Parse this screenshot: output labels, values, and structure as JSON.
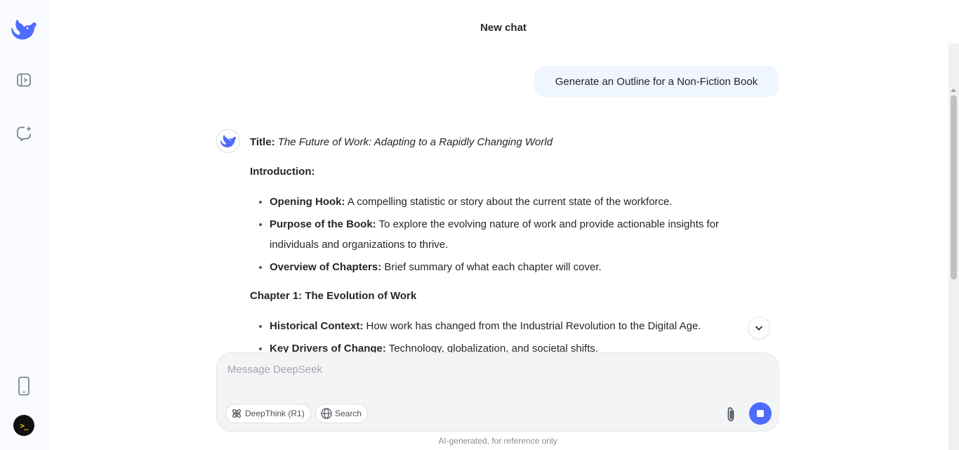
{
  "header": {
    "title": "New chat"
  },
  "user_message": {
    "text": "Generate an Outline for a Non-Fiction Book"
  },
  "answer": {
    "title_label": "Title:",
    "title_text": "The Future of Work: Adapting to a Rapidly Changing World",
    "intro_heading": "Introduction:",
    "intro_items": [
      {
        "label": "Opening Hook:",
        "text": "A compelling statistic or story about the current state of the workforce."
      },
      {
        "label": "Purpose of the Book:",
        "text": "To explore the evolving nature of work and provide actionable insights for individuals and organizations to thrive."
      },
      {
        "label": "Overview of Chapters:",
        "text": "Brief summary of what each chapter will cover."
      }
    ],
    "chapter1_heading": "Chapter 1: The Evolution of Work",
    "chapter1_items": [
      {
        "label": "Historical Context:",
        "text": "How work has changed from the Industrial Revolution to the Digital Age."
      },
      {
        "label": "Key Drivers of Change:",
        "text": "Technology, globalization, and societal shifts."
      }
    ]
  },
  "composer": {
    "placeholder": "Message DeepSeek",
    "deepthink_label": "DeepThink (R1)",
    "search_label": "Search"
  },
  "footer": {
    "note": "AI-generated, for reference only"
  },
  "colors": {
    "accent": "#4d6bfe",
    "user_bubble": "#eff6ff",
    "sidebar_bg": "#f9fbff"
  },
  "icons": {
    "logo": "whale-logo-icon",
    "toggle": "sidebar-toggle-icon",
    "new_chat": "new-chat-icon",
    "phone": "mobile-app-icon",
    "avatar": "terminal-avatar"
  }
}
